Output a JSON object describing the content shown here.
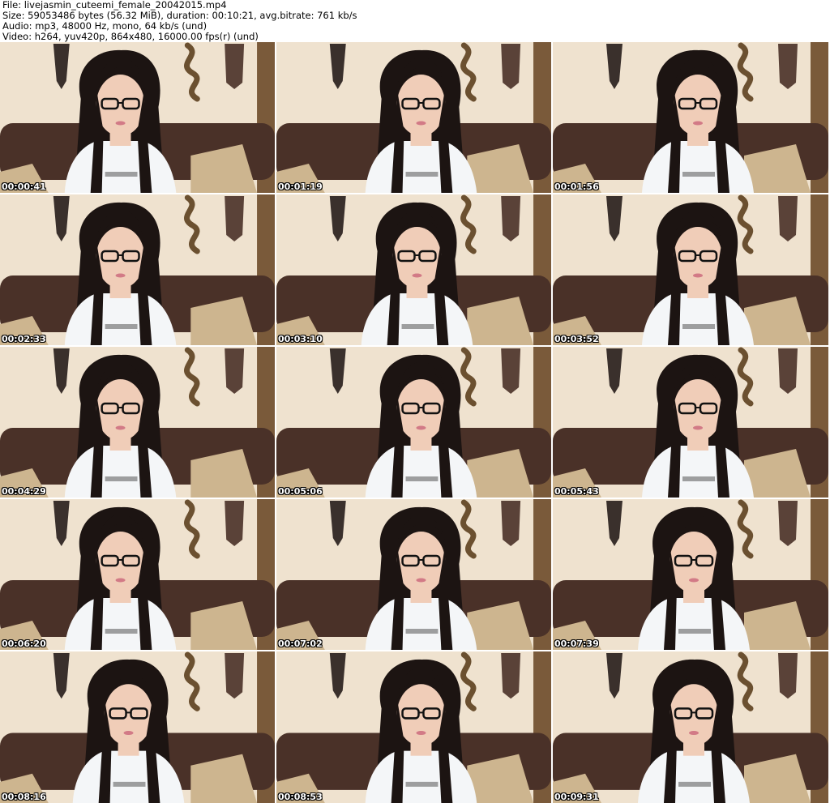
{
  "info": {
    "file": "File: livejasmin_cuteemi_female_20042015.mp4",
    "size": "Size: 59053486 bytes (56.32 MiB), duration: 00:10:21, avg.bitrate: 761 kb/s",
    "audio": "Audio: mp3, 48000 Hz, mono, 64 kb/s (und)",
    "video": "Video: h264, yuv420p, 864x480, 16000.00 fps(r) (und)"
  },
  "thumbnails": [
    {
      "time": "00:00:41"
    },
    {
      "time": "00:01:19"
    },
    {
      "time": "00:01:56"
    },
    {
      "time": "00:02:33"
    },
    {
      "time": "00:03:10"
    },
    {
      "time": "00:03:52"
    },
    {
      "time": "00:04:29"
    },
    {
      "time": "00:05:06"
    },
    {
      "time": "00:05:43"
    },
    {
      "time": "00:06:20"
    },
    {
      "time": "00:07:02"
    },
    {
      "time": "00:07:39"
    },
    {
      "time": "00:08:16"
    },
    {
      "time": "00:08:53"
    },
    {
      "time": "00:09:31"
    }
  ],
  "colors": {
    "wall": "#efe2cf",
    "sofa": "#4a3128",
    "cushion": "#cdb58f",
    "hair": "#1c1412",
    "skin": "#f0cdb8",
    "shirt": "#f4f6f8",
    "mask": "#3a302c"
  }
}
